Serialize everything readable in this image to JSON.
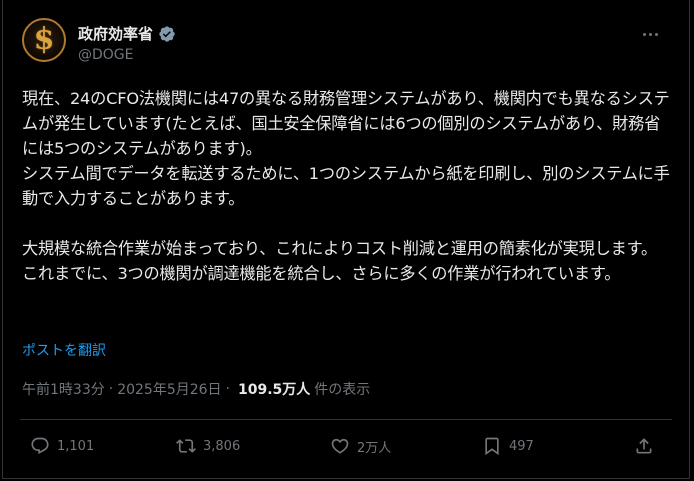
{
  "author": {
    "display_name": "政府効率省",
    "handle": "@DOGE",
    "verified": true,
    "avatar_icon": "dollar-sign-icon"
  },
  "post": {
    "text": "現在、24のCFO法機関には47の異なる財務管理システムがあり、機関内でも異なるシステムが発生しています(たとえば、国土安全保障省には6つの個別のシステムがあり、財務省には5つのシステムがあります)。\nシステム間でデータを転送するために、1つのシステムから紙を印刷し、別のシステムに手動で入力することがあります。\n\n大規模な統合作業が始まっており、これによりコスト削減と運用の簡素化が実現します。これまでに、3つの機関が調達機能を統合し、さらに多くの作業が行われています。",
    "translate_label": "ポストを翻訳"
  },
  "meta": {
    "time": "午前1時33分",
    "dot1": "·",
    "date": "2025年5月26日",
    "dot2": "·",
    "views": "109.5万人",
    "views_suffix": "件の表示"
  },
  "actions": {
    "replies": "1,101",
    "reposts": "3,806",
    "likes": "2万人",
    "bookmarks": "497"
  },
  "colors": {
    "background": "#000000",
    "text": "#e7e9ea",
    "secondary": "#71767b",
    "link": "#1d9bf0",
    "border": "#2f3336"
  }
}
